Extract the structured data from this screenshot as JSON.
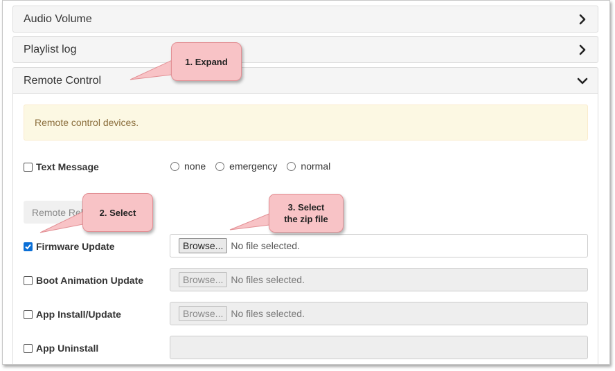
{
  "panels": {
    "audio_volume": "Audio Volume",
    "playlist_log": "Playlist log",
    "remote_control": "Remote Control"
  },
  "remote": {
    "alert": "Remote control devices.",
    "text_message": {
      "label": "Text Message",
      "options": [
        "none",
        "emergency",
        "normal"
      ]
    },
    "remote_button": "Remote Rel",
    "firmware": {
      "label": "Firmware Update",
      "browse": "Browse...",
      "status": "No file selected.",
      "checked": true
    },
    "boot_animation": {
      "label": "Boot Animation Update",
      "browse": "Browse...",
      "status": "No files selected."
    },
    "app_install": {
      "label": "App Install/Update",
      "browse": "Browse...",
      "status": "No files selected."
    },
    "app_uninstall": {
      "label": "App Uninstall"
    }
  },
  "callouts": {
    "expand": "1. Expand",
    "select": "2. Select",
    "select_zip_line1": "3. Select",
    "select_zip_line2": "the zip file"
  },
  "colors": {
    "alert_bg": "#fcf8e3",
    "alert_text": "#8a6d3b",
    "callout_bg": "#f8c3c6",
    "checkbox_checked": "#0b6fd6"
  }
}
